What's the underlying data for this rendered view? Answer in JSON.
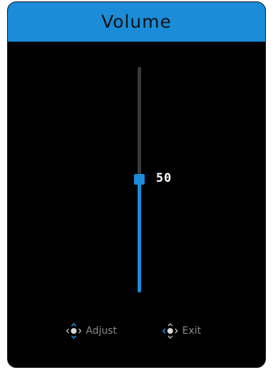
{
  "osd": {
    "title": "Volume",
    "accent_color": "#1a8cd8"
  },
  "slider": {
    "value": 50,
    "min": 0,
    "max": 100,
    "value_label": "50"
  },
  "hints": [
    {
      "icon": "joystick-up-down-icon",
      "label": "Adjust"
    },
    {
      "icon": "joystick-left-icon",
      "label": "Exit"
    }
  ]
}
